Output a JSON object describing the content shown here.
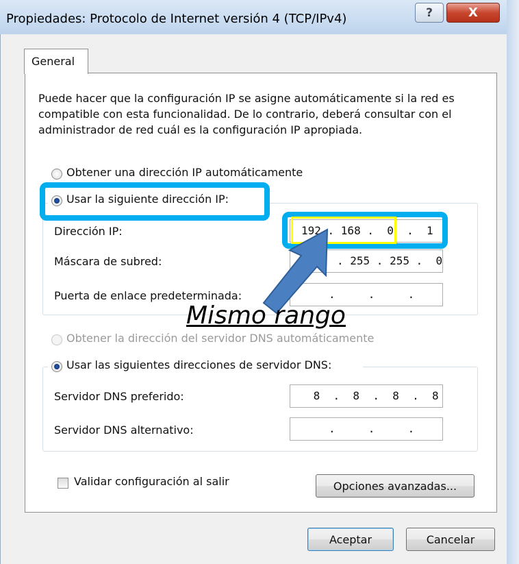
{
  "window": {
    "title": "Propiedades: Protocolo de Internet versión 4 (TCP/IPv4)",
    "help_glyph": "?",
    "close_glyph": "X"
  },
  "tabs": [
    {
      "label": "General"
    }
  ],
  "description": "Puede hacer que la configuración IP se asigne automáticamente si la red es compatible con esta funcionalidad. De lo contrario, deberá consultar con el administrador de red cuál es la configuración IP apropiada.",
  "ip_mode": {
    "auto_label": "Obtener una dirección IP automáticamente",
    "manual_label": "Usar la siguiente dirección IP:",
    "selected": "manual"
  },
  "ip_fields": {
    "ip_label": "Dirección IP:",
    "ip_value": "192 . 168 .  0  .  1",
    "mask_label": "Máscara de subred:",
    "mask_value": ". 255 . 255 .  0",
    "gateway_label": "Puerta de enlace predeterminada:",
    "gateway_value": ".     .     ."
  },
  "dns_mode": {
    "auto_label": "Obtener la dirección del servidor DNS automáticamente",
    "manual_label": "Usar las siguientes direcciones de servidor DNS:",
    "selected": "manual"
  },
  "dns_fields": {
    "preferred_label": "Servidor DNS preferido:",
    "preferred_value": " 8  .  8  .  8  .  8",
    "alternate_label": "Servidor DNS alternativo:",
    "alternate_value": ".     .     ."
  },
  "validate_label": "Validar configuración al salir",
  "advanced_button": "Opciones avanzadas...",
  "ok_button": "Aceptar",
  "cancel_button": "Cancelar",
  "annotation": {
    "text": "Mismo rango",
    "highlight_color": "#00aeef",
    "ip_highlight_color": "#ffff00",
    "arrow_color": "#4a7fc1"
  }
}
